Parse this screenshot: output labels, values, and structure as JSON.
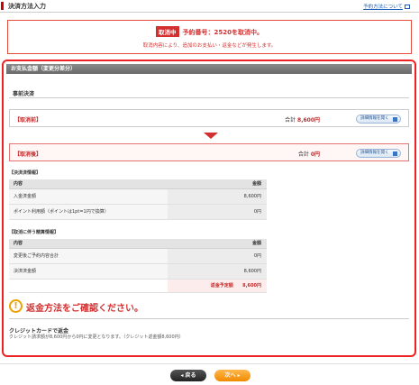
{
  "header": {
    "title": "決済方法入力",
    "help_link": "予約方法について"
  },
  "alert": {
    "badge": "取消中",
    "main_text": "予約番号：2520を取消中。",
    "sub_text": "取消内容により、追加のお支払い・返金などが発生します。"
  },
  "payment": {
    "section_title": "お支払金額（変更分差分）",
    "subsection": "事前決済",
    "before": {
      "label": "【取消前】",
      "sum_label": "合計",
      "sum_value": "8,600円",
      "details_button": "詳細情報を開く"
    },
    "after": {
      "label": "【取消後】",
      "sum_label": "合計",
      "sum_value": "0円",
      "details_button": "詳細情報を開く"
    }
  },
  "settlement": {
    "title": "【決済済情報】",
    "headers": [
      "内容",
      "金額"
    ],
    "rows": [
      {
        "item": "入金済金額",
        "amount": "8,600円"
      },
      {
        "item": "ポイント利用額（ポイントは1pt=1円で換算）",
        "amount": "0円"
      }
    ]
  },
  "cancellation": {
    "title": "【取消に伴う精算情報】",
    "headers": [
      "内容",
      "金額"
    ],
    "rows": [
      {
        "item": "変更後ご予約内容合計",
        "amount": "0円"
      },
      {
        "item": "決済済金額",
        "amount": "8,600円"
      }
    ],
    "total_label": "返金予定額",
    "total_value": "8,600円"
  },
  "refund_notice": {
    "icon": "!",
    "text": "返金方法をご確認ください。",
    "method": "クレジットカードで返金",
    "note": "クレジット請求額が8,600円から0円に変更となります。（クレジット返金額8,600円）"
  },
  "nav": {
    "back_label": "◂ 戻る",
    "next_label": "次へ ▸"
  }
}
